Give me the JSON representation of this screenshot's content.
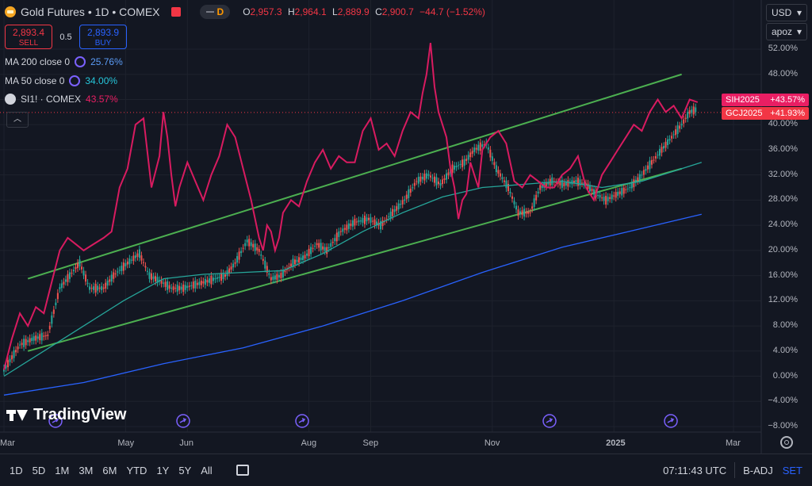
{
  "header": {
    "title": "Gold Futures • 1D • COMEX",
    "pill_label": "D",
    "ohlc": {
      "o_label": "O",
      "o": "2,957.3",
      "h_label": "H",
      "h": "2,964.1",
      "l_label": "L",
      "l": "2,889.9",
      "c_label": "C",
      "c": "2,900.7",
      "change": "−44.7 (−1.52%)"
    }
  },
  "trade": {
    "sell_price": "2,893.4",
    "sell_label": "SELL",
    "spread": "0.5",
    "buy_price": "2,893.9",
    "buy_label": "BUY"
  },
  "legend": [
    {
      "label": "MA 200 close 0",
      "value": "25.76%",
      "color": "#5b9cf6",
      "icon": "refresh-icon"
    },
    {
      "label": "MA 50 close 0",
      "value": "34.00%",
      "color": "#26c6da",
      "icon": "refresh-icon"
    },
    {
      "label": "SI1! · COMEX",
      "value": "43.57%",
      "color": "#e91e63",
      "icon": "silver-icon"
    }
  ],
  "collapse_icon": "chevron-up-icon",
  "currency": {
    "label": "USD",
    "chevron": "▾"
  },
  "scale_mode": {
    "label": "apoz",
    "chevron": "▾"
  },
  "tags": [
    {
      "name": "SIH2025",
      "value": "+43.57%",
      "color": "#e91e63"
    },
    {
      "name": "GCJ2025",
      "value": "+41.93%",
      "color": "#f23645"
    }
  ],
  "chart_data": {
    "type": "line",
    "y_axis_labels": [
      "52.00%",
      "48.00%",
      "44.00%",
      "40.00%",
      "36.00%",
      "32.00%",
      "28.00%",
      "24.00%",
      "20.00%",
      "16.00%",
      "12.00%",
      "8.00%",
      "4.00%",
      "0.00%",
      "−4.00%",
      "−8.00%"
    ],
    "y_axis_values": [
      52,
      48,
      44,
      40,
      36,
      32,
      28,
      24,
      20,
      16,
      12,
      8,
      4,
      0,
      -4,
      -8
    ],
    "ylim": [
      -9.5,
      54
    ],
    "x_axis_labels": [
      "Mar",
      "May",
      "Jun",
      "Aug",
      "Sep",
      "Nov",
      "2025",
      "Mar"
    ],
    "x_axis_days": [
      0,
      61,
      92,
      153,
      184,
      245,
      306,
      366
    ],
    "xlim": [
      0,
      366
    ],
    "series": [
      {
        "name": "Gold Futures",
        "kind": "candles",
        "x": [
          0,
          8,
          15,
          22,
          28,
          33,
          38,
          43,
          50,
          55,
          62,
          68,
          73,
          79,
          84,
          90,
          95,
          101,
          106,
          111,
          116,
          122,
          128,
          134,
          139,
          145,
          151,
          157,
          162,
          169,
          176,
          183,
          189,
          195,
          201,
          207,
          213,
          219,
          225,
          231,
          236,
          242,
          247,
          253,
          258,
          264,
          269,
          275,
          281,
          287,
          292,
          297,
          302,
          308,
          314,
          320,
          325,
          330,
          335,
          340,
          344,
          348
        ],
        "values": [
          1,
          5,
          6,
          6.5,
          14,
          16,
          18,
          14,
          14,
          16,
          18,
          19.5,
          16,
          15,
          14,
          14,
          14.5,
          15,
          15.5,
          16,
          18,
          21.5,
          20,
          15.5,
          16,
          18,
          19,
          21,
          20,
          23,
          24.5,
          25,
          24,
          26,
          28,
          31,
          32,
          30.5,
          33,
          34,
          36,
          37,
          33,
          30,
          26,
          26,
          30,
          31,
          30.5,
          31,
          30.5,
          29,
          28,
          29,
          30,
          32,
          34,
          36,
          38,
          40,
          42,
          42.5
        ]
      },
      {
        "name": "MA 50 close 0",
        "x": [
          0,
          20,
          40,
          60,
          80,
          100,
          120,
          140,
          160,
          180,
          200,
          220,
          240,
          260,
          280,
          300,
          320,
          340,
          350
        ],
        "values": [
          0,
          4,
          8,
          12,
          15.5,
          16.2,
          16.5,
          16.8,
          19.5,
          23,
          26,
          28.5,
          30,
          30.5,
          31,
          30,
          31,
          33,
          34
        ]
      },
      {
        "name": "MA 200 close 0",
        "x": [
          0,
          40,
          80,
          120,
          160,
          200,
          240,
          280,
          320,
          350
        ],
        "values": [
          -3,
          -1,
          2,
          4.5,
          8,
          12,
          16.5,
          20.5,
          23.5,
          25.76
        ]
      },
      {
        "name": "SI1! · COMEX",
        "x": [
          0,
          4,
          8,
          12,
          16,
          20,
          24,
          28,
          32,
          36,
          40,
          45,
          50,
          54,
          58,
          62,
          66,
          70,
          74,
          78,
          80,
          82,
          84,
          86,
          88,
          92,
          96,
          100,
          104,
          108,
          112,
          116,
          120,
          124,
          128,
          130,
          132,
          134,
          136,
          138,
          140,
          144,
          148,
          152,
          156,
          160,
          164,
          168,
          172,
          176,
          180,
          184,
          188,
          192,
          196,
          200,
          204,
          208,
          210,
          212,
          214,
          216,
          218,
          220,
          222,
          224,
          226,
          228,
          230,
          232,
          234,
          236,
          238,
          240,
          244,
          248,
          252,
          256,
          260,
          264,
          268,
          272,
          276,
          280,
          284,
          288,
          292,
          296,
          300,
          304,
          308,
          312,
          316,
          320,
          324,
          328,
          332,
          336,
          340,
          344,
          348
        ],
        "values": [
          1,
          6,
          10,
          8,
          11,
          10,
          15,
          20,
          22,
          21,
          20,
          21,
          22,
          23,
          30,
          33,
          40,
          41,
          30,
          35,
          42,
          38,
          32,
          27,
          30,
          34,
          31,
          28,
          32,
          35,
          40,
          38,
          33,
          28,
          22,
          20,
          24,
          23,
          20,
          22,
          26,
          28,
          27,
          31,
          34,
          36,
          33,
          35,
          34,
          34,
          39,
          41,
          36,
          37,
          35,
          39,
          42,
          41,
          45,
          48,
          53,
          46,
          42,
          40,
          38,
          33,
          30,
          25,
          28,
          29,
          34,
          32,
          30,
          36,
          38,
          39,
          37,
          31,
          30,
          32,
          31,
          30,
          30,
          32,
          33,
          35,
          30,
          28,
          32,
          34,
          36,
          38,
          40,
          39,
          42,
          44,
          42,
          43,
          41,
          44,
          43.57
        ]
      }
    ],
    "channel": {
      "upper": {
        "x": [
          12,
          340
        ],
        "values": [
          15.5,
          48
        ]
      },
      "lower": {
        "x": [
          12,
          340
        ],
        "values": [
          4,
          33
        ]
      }
    },
    "last_price_line": 41.93,
    "grid": true,
    "legend": "top-left"
  },
  "watermark": "TradingView",
  "event_icon": "forward-icon",
  "settings_icon": "gear-icon",
  "bottom_bar": {
    "timeframes": [
      "1D",
      "5D",
      "1M",
      "3M",
      "6M",
      "YTD",
      "1Y",
      "5Y",
      "All"
    ],
    "compare_icon": "compare-icon",
    "time": "07:11:43 UTC",
    "adj": "B-ADJ",
    "set": "SET"
  }
}
